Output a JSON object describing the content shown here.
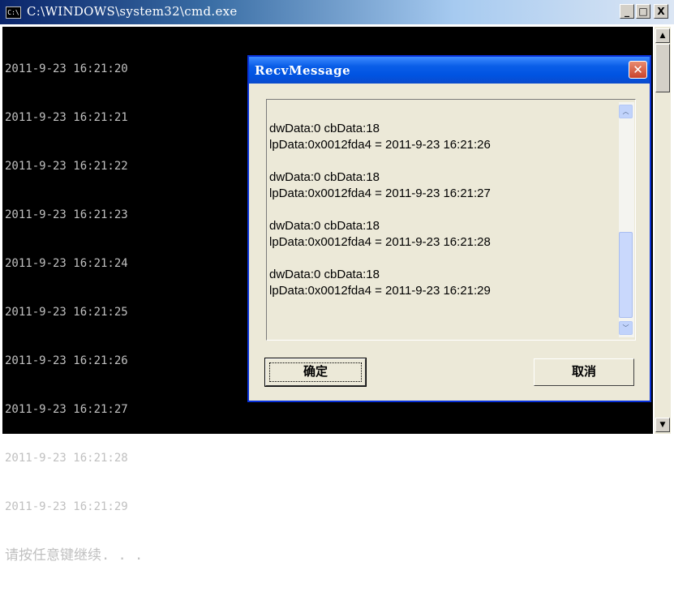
{
  "console_window": {
    "title": "C:\\WINDOWS\\system32\\cmd.exe",
    "icon_text": "C:\\",
    "buttons": {
      "minimize": "_",
      "maximize": "□",
      "close": "X"
    },
    "lines": [
      "2011-9-23 16:21:20",
      "2011-9-23 16:21:21",
      "2011-9-23 16:21:22",
      "2011-9-23 16:21:23",
      "2011-9-23 16:21:24",
      "2011-9-23 16:21:25",
      "2011-9-23 16:21:26",
      "2011-9-23 16:21:27",
      "2011-9-23 16:21:28",
      "2011-9-23 16:21:29"
    ],
    "prompt": "请按任意键继续. . .",
    "scroll_up": "▲",
    "scroll_down": "▼"
  },
  "dialog": {
    "title": "RecvMessage",
    "close": "✕",
    "messages": [
      {
        "line1": "dwData:0 cbData:18",
        "line2": "lpData:0x0012fda4 = 2011-9-23 16:21:26"
      },
      {
        "line1": "dwData:0 cbData:18",
        "line2": "lpData:0x0012fda4 = 2011-9-23 16:21:27"
      },
      {
        "line1": "dwData:0 cbData:18",
        "line2": "lpData:0x0012fda4 = 2011-9-23 16:21:28"
      },
      {
        "line1": "dwData:0 cbData:18",
        "line2": "lpData:0x0012fda4 = 2011-9-23 16:21:29"
      }
    ],
    "scroll_up": "︿",
    "scroll_down": "﹀",
    "ok_label": "确定",
    "cancel_label": "取消"
  },
  "colors": {
    "console_bg": "#000000",
    "console_text": "#c0c0c0",
    "dialog_bg": "#ece9d8",
    "dialog_titlebar": "#0053e1"
  }
}
